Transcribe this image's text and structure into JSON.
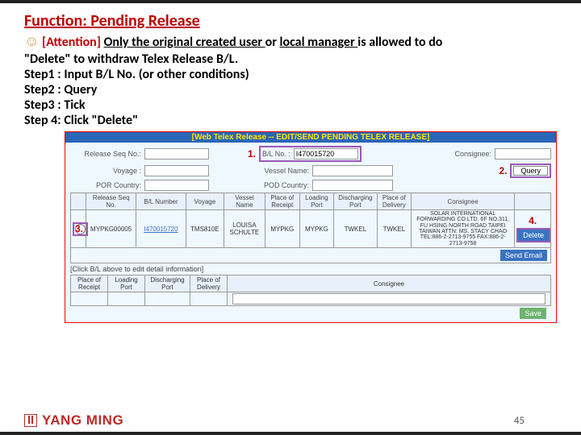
{
  "header": {
    "title": "Function: Pending Release"
  },
  "attention": {
    "emoji": "☺",
    "tag": "[Attention] ",
    "part1": "Only the original created user ",
    "part2": "or ",
    "part3": "local manager ",
    "part4": "is allowed to do",
    "line2": "\"Delete\" to withdraw Telex Release B/L."
  },
  "steps": {
    "s1": "Step1 : Input B/L No. (or other conditions)",
    "s2": "Step2 : Query",
    "s3": "Step3 : Tick",
    "s4": "Step 4: Click \"Delete\""
  },
  "app": {
    "title": "[Web Telex Release -- EDIT/SEND PENDING TELEX RELEASE]",
    "ann1": "1.",
    "ann2": "2.",
    "ann3": "3.",
    "ann4": "4.",
    "labels": {
      "releaseSeq": "Release Seq No.:",
      "blno": "B/L No. :",
      "consignee": "Consignee:",
      "voyage": "Voyage :",
      "vessel": "Vessel Name:",
      "por": "POR Country:",
      "pod": "POD Country:"
    },
    "values": {
      "blno": "I470015720"
    },
    "buttons": {
      "query": "Query",
      "delete": "Delete",
      "send": "Send Email",
      "save": "Save"
    },
    "gridHeaders": [
      "",
      "Release Seq No.",
      "B/L Number",
      "Voyage",
      "Vessel Name",
      "Place of Receipt",
      "Loading Port",
      "Discharging Port",
      "Place of Delivery",
      "Consignee",
      ""
    ],
    "row": {
      "seq": "MYPKG00005",
      "bl": "I470015720",
      "voyage": "TMS810E",
      "vessel": "LOUISA SCHULTE",
      "por": "MYPKG",
      "lp": "MYPKG",
      "dp": "TWKEL",
      "pod": "TWKEL",
      "consignee": "SOLAR INTERNATIONAL FORWARDING CO.LTD. 6F NO.311, FU HSING NORTH ROAD TAIPEI TAIWAN ATTN: MS. STACY CHAO TEL:886-2-2713-9755 FAX:886-2-2713-9758"
    },
    "hint": "[Click B/L above to edit detail information]",
    "grid2Headers": [
      "Place of Receipt",
      "Loading Port",
      "Discharging Port",
      "Place of Delivery",
      "Consignee"
    ]
  },
  "page": {
    "number": "45"
  },
  "brand": {
    "name": "YANG MING"
  }
}
